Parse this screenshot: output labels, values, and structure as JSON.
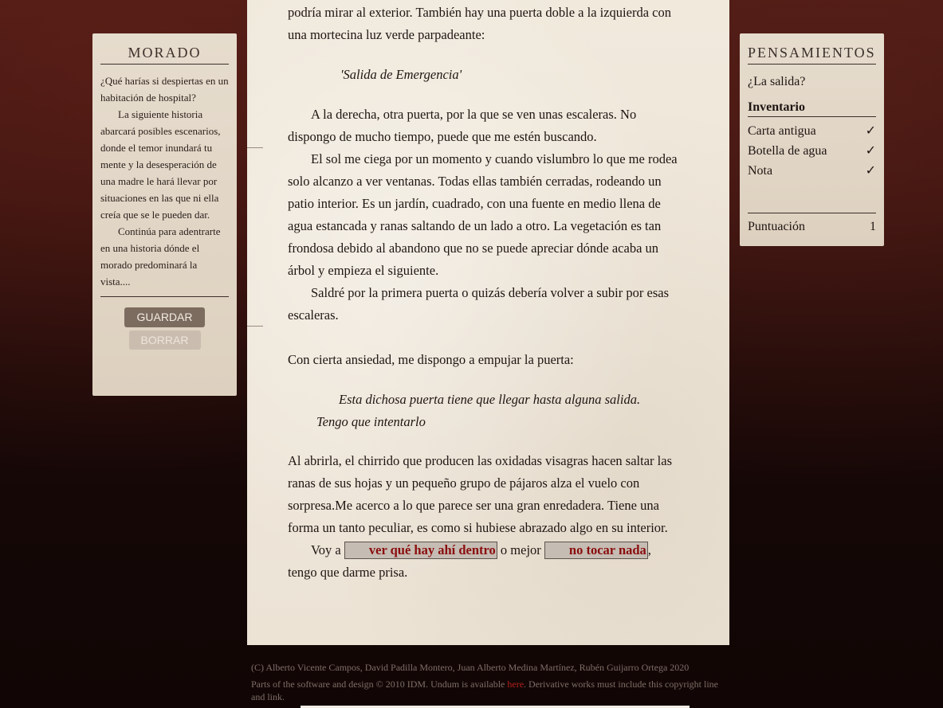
{
  "left_panel": {
    "title": "MORADO",
    "intro": [
      "¿Qué harías si despiertas en un habitación de hospital?",
      "La siguiente historia abarcará posibles escenarios, donde el temor inundará tu mente y la desesperación de una madre le hará llevar por situaciones en las que ni ella creía que se le pueden dar.",
      "Continúa para adentrarte en una historia dónde el morado predominará la vista...."
    ],
    "save_label": "GUARDAR",
    "erase_label": "BORRAR"
  },
  "right_panel": {
    "title": "PENSAMIENTOS",
    "thought": "¿La salida?",
    "inventory_title": "Inventario",
    "inventory": [
      {
        "name": "Carta antigua",
        "check": "✓"
      },
      {
        "name": "Botella de agua",
        "check": "✓"
      },
      {
        "name": "Nota",
        "check": "✓"
      }
    ],
    "score_label": "Puntuación",
    "score_value": "1"
  },
  "story": {
    "p1": "podría mirar al exterior. También hay una puerta doble a la izquierda con una mortecina luz verde parpadeante:",
    "quote1": "'Salida de Emergencia'",
    "p2": "A la derecha, otra puerta, por la que se ven unas escaleras. No dispongo de mucho tiempo, puede que me estén buscando.",
    "p3": "El sol me ciega por un momento y cuando vislumbro lo que me rodea solo alcanzo a ver ventanas. Todas ellas también cerradas, rodeando un patio interior. Es un jardín, cuadrado, con una fuente en medio llena de agua estancada y ranas saltando de un lado a otro. La vegetación es tan frondosa debido al abandono que no se puede apreciar dónde acaba un árbol y empieza el siguiente.",
    "p4": "Saldré por la primera puerta o quizás debería volver a subir por esas escaleras.",
    "p5": "Con cierta ansiedad, me dispongo a empujar la puerta:",
    "quote2_line1": "Esta dichosa puerta tiene que llegar hasta alguna salida.",
    "quote2_line2": "Tengo que intentarlo",
    "p6": "Al abrirla, el chirrido que producen las oxidadas visagras hacen saltar las ranas de sus hojas y un pequeño grupo de pájaros alza el vuelo con sorpresa.Me acerco a lo que parece ser una gran enredadera. Tiene una forma un tanto peculiar, es como si hubiese abrazado algo en su interior.",
    "p7_start": "Voy a ",
    "choice1": "ver qué hay ahí dentro",
    "p7_mid": " o mejor ",
    "choice2": "no tocar nada",
    "p7_end": ", tengo que darme prisa."
  },
  "footer": {
    "copyright": "(C) Alberto Vicente Campos, David Padilla Montero, Juan Alberto Medina Martínez, Rubén Guijarro Ortega 2020",
    "credits_start": "Parts of the software and design © 2010 IDM. Undum is available ",
    "credits_link": "here",
    "credits_end": ". Derivative works must include this copyright line and link."
  }
}
